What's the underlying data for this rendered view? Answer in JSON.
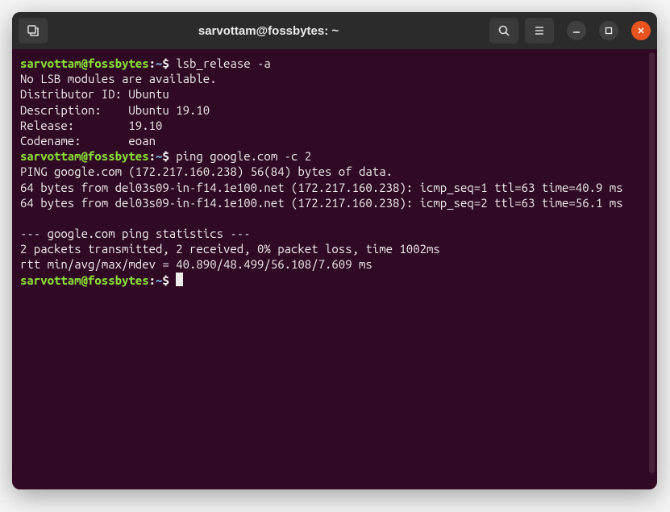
{
  "titlebar": {
    "title": "sarvottam@fossbytes: ~"
  },
  "prompt": {
    "user_host": "sarvottam@fossbytes",
    "sep": ":",
    "path": "~",
    "dollar": "$"
  },
  "session": {
    "cmd1": "lsb_release -a",
    "out1_l1": "No LSB modules are available.",
    "out1_l2": "Distributor ID: Ubuntu",
    "out1_l3": "Description:    Ubuntu 19.10",
    "out1_l4": "Release:        19.10",
    "out1_l5": "Codename:       eoan",
    "cmd2": "ping google.com -c 2",
    "out2_l1": "PING google.com (172.217.160.238) 56(84) bytes of data.",
    "out2_l2": "64 bytes from del03s09-in-f14.1e100.net (172.217.160.238): icmp_seq=1 ttl=63 time=40.9 ms",
    "out2_l3": "64 bytes from del03s09-in-f14.1e100.net (172.217.160.238): icmp_seq=2 ttl=63 time=56.1 ms",
    "out2_l4": "",
    "out2_l5": "--- google.com ping statistics ---",
    "out2_l6": "2 packets transmitted, 2 received, 0% packet loss, time 1002ms",
    "out2_l7": "rtt min/avg/max/mdev = 40.890/48.499/56.108/7.609 ms"
  }
}
